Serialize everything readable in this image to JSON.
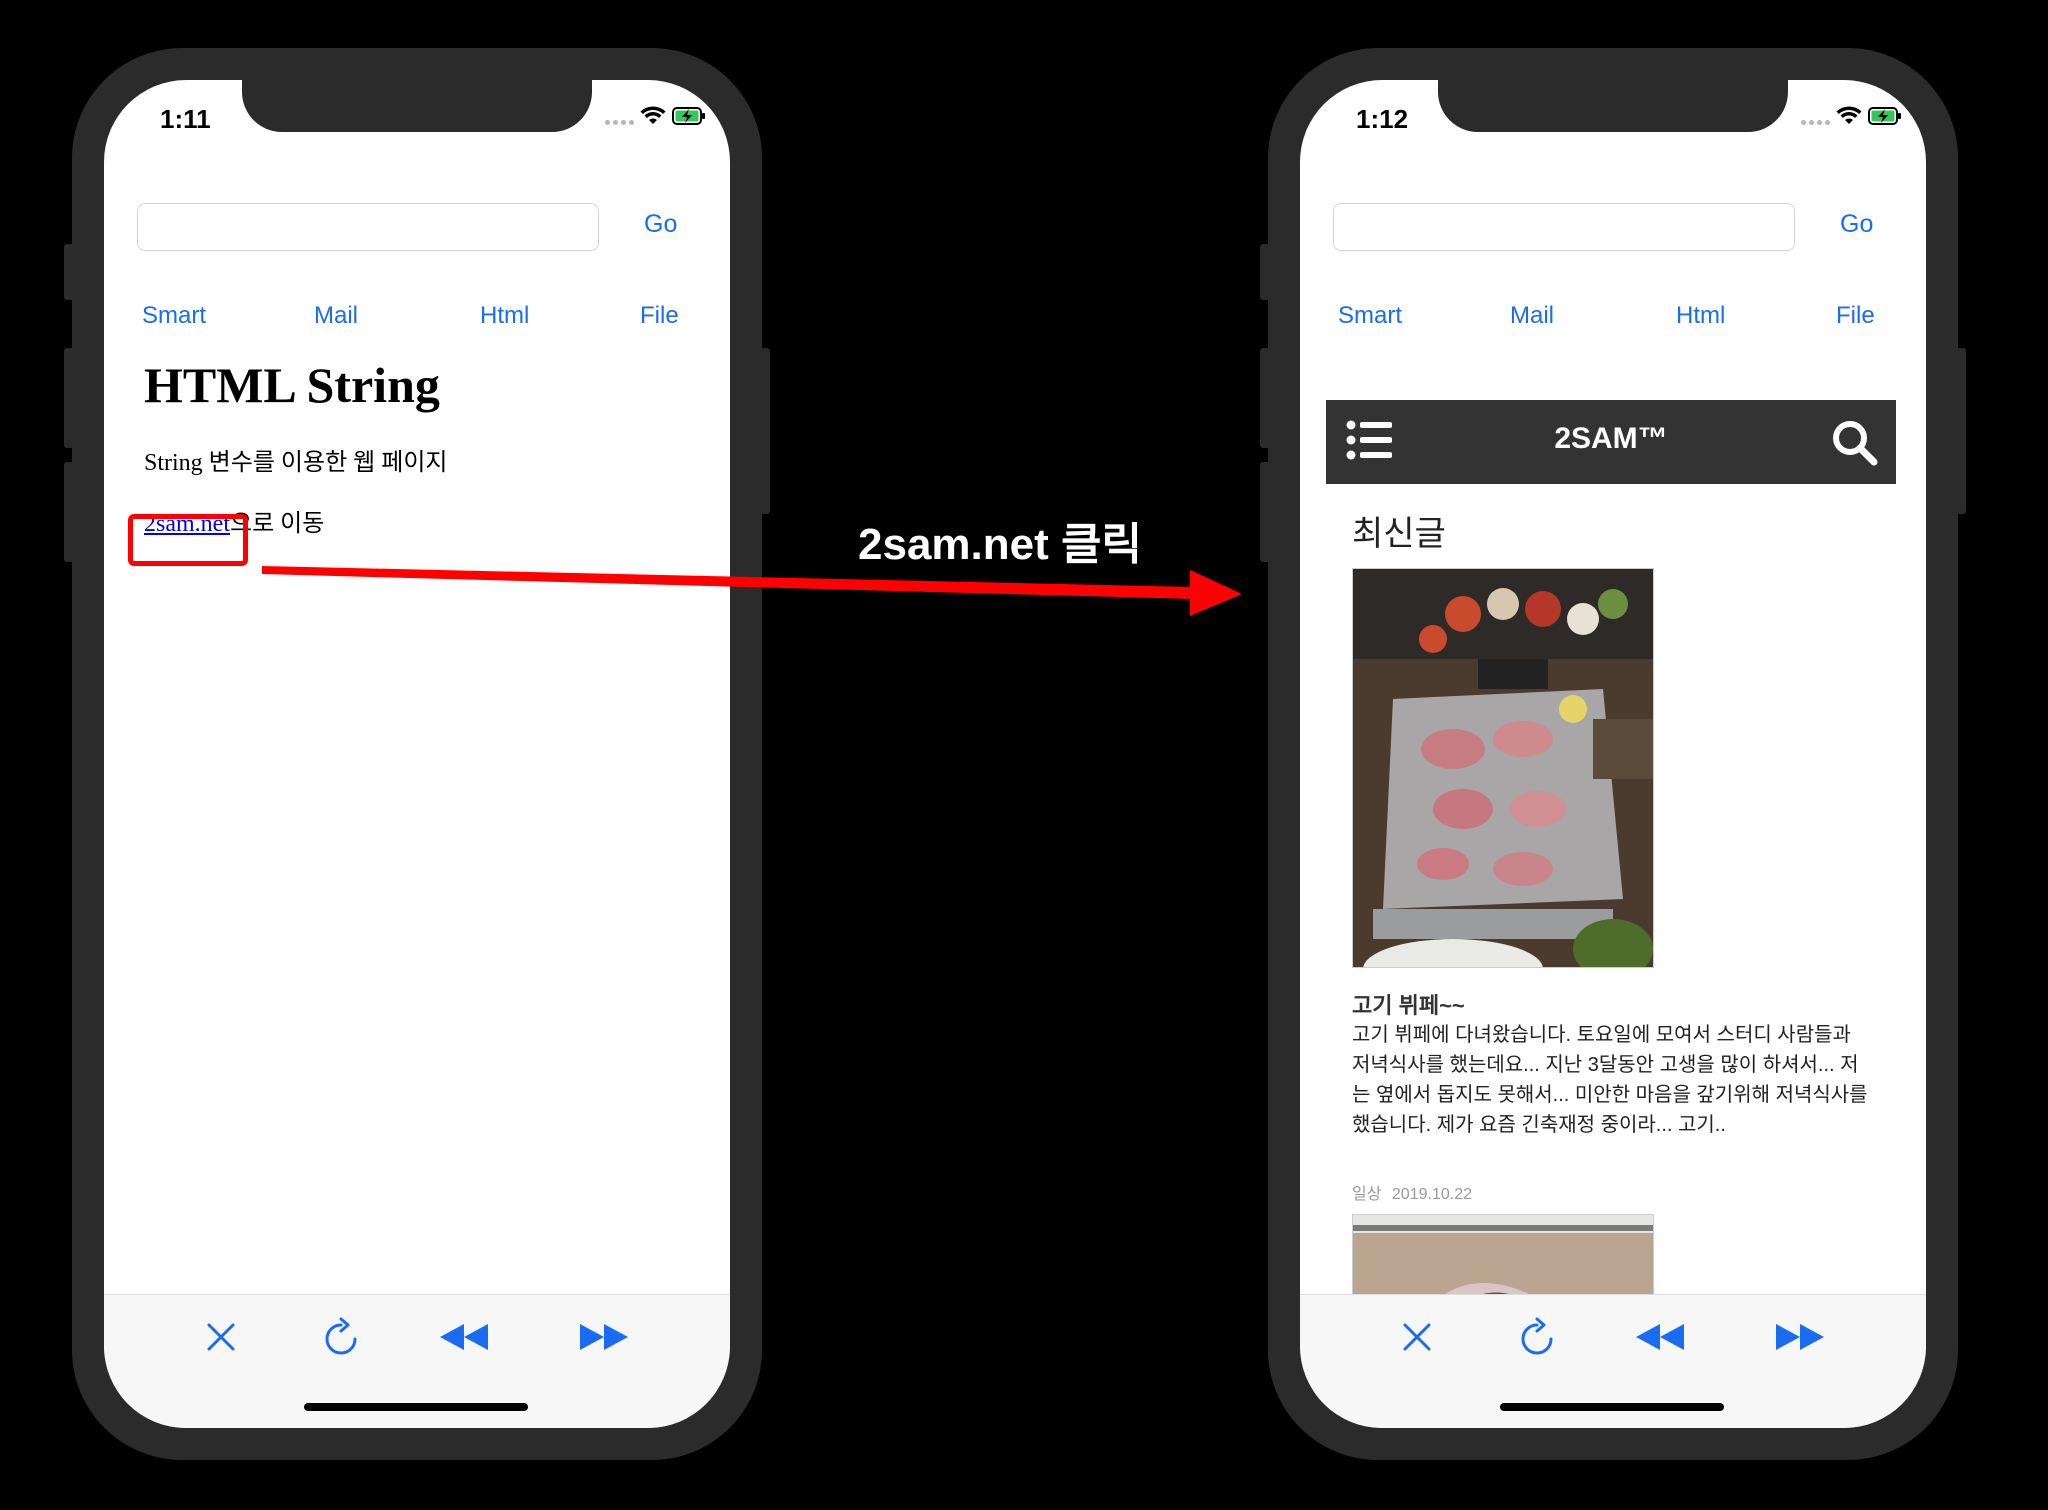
{
  "annotation": {
    "label": "2sam.net 클릭",
    "arrow_color": "#ff0000",
    "highlight_color": "#ff0000"
  },
  "accent_color": "#1a6cf2",
  "left_phone": {
    "time": "1:11",
    "go_label": "Go",
    "url_value": "",
    "tabs": [
      "Smart",
      "Mail",
      "Html",
      "File"
    ],
    "page": {
      "heading": "HTML String",
      "description": "String 변수를 이용한 웹 페이지",
      "link_text": "2sam.net",
      "link_suffix": "으로 이동"
    },
    "toolbar_icons": [
      "close-icon",
      "reload-icon",
      "rewind-icon",
      "fast-forward-icon"
    ]
  },
  "right_phone": {
    "time": "1:12",
    "go_label": "Go",
    "url_value": "",
    "tabs": [
      "Smart",
      "Mail",
      "Html",
      "File"
    ],
    "site": {
      "title": "2SAM™",
      "section_title": "최신글",
      "post": {
        "title": "고기 뷔페~~",
        "excerpt": "고기 뷔페에 다녀왔습니다. 토요일에 모여서 스터디 사람들과 저녁식사를 했는데요... 지난 3달동안 고생을 많이 하셔서... 저는 옆에서 돕지도 못해서... 미안한 마음을 갚기위해 저녁식사를 했습니다. 제가 요즘 긴축재정 중이라... 고기..",
        "category": "일상",
        "date": "2019.10.22"
      }
    },
    "toolbar_icons": [
      "close-icon",
      "reload-icon",
      "rewind-icon",
      "fast-forward-icon"
    ]
  }
}
